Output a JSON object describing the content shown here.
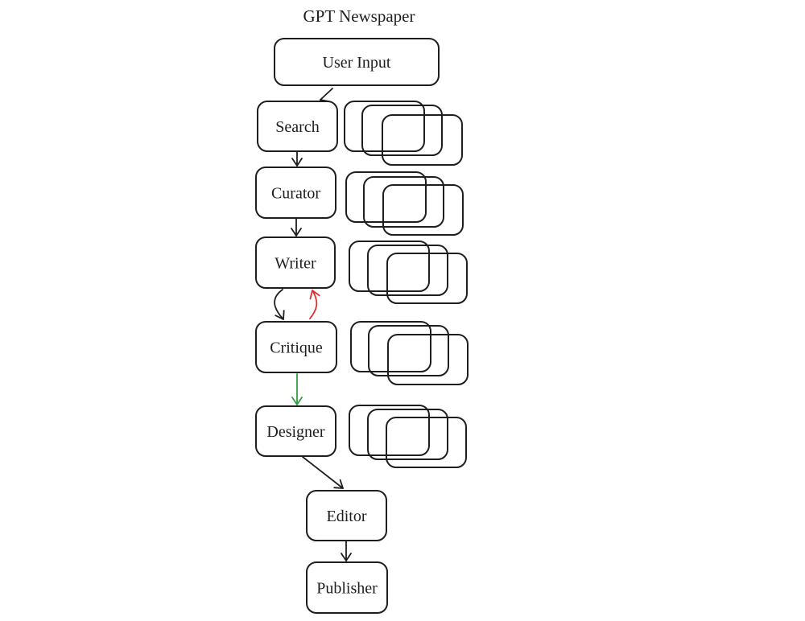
{
  "title": "GPT Newspaper",
  "colors": {
    "stroke": "#1e1e1e",
    "default_edge": "#1e1e1e",
    "revision_edge": "#e03131",
    "approve_edge": "#2f9e44",
    "background": "#ffffff"
  },
  "nodes": [
    {
      "id": "user-input",
      "label": "User Input"
    },
    {
      "id": "search",
      "label": "Search"
    },
    {
      "id": "curator",
      "label": "Curator"
    },
    {
      "id": "writer",
      "label": "Writer"
    },
    {
      "id": "critique",
      "label": "Critique"
    },
    {
      "id": "designer",
      "label": "Designer"
    },
    {
      "id": "editor",
      "label": "Editor"
    },
    {
      "id": "publisher",
      "label": "Publisher"
    }
  ],
  "parallel_stacks": [
    {
      "beside": "search",
      "count": 3
    },
    {
      "beside": "curator",
      "count": 3
    },
    {
      "beside": "writer",
      "count": 3
    },
    {
      "beside": "critique",
      "count": 3
    },
    {
      "beside": "designer",
      "count": 3
    }
  ],
  "edges": [
    {
      "from": "user-input",
      "to": "search",
      "color": "default_edge"
    },
    {
      "from": "search",
      "to": "curator",
      "color": "default_edge"
    },
    {
      "from": "curator",
      "to": "writer",
      "color": "default_edge"
    },
    {
      "from": "writer",
      "to": "critique",
      "color": "default_edge"
    },
    {
      "from": "critique",
      "to": "writer",
      "color": "revision_edge"
    },
    {
      "from": "critique",
      "to": "designer",
      "color": "approve_edge"
    },
    {
      "from": "designer",
      "to": "editor",
      "color": "default_edge"
    },
    {
      "from": "editor",
      "to": "publisher",
      "color": "default_edge"
    }
  ]
}
